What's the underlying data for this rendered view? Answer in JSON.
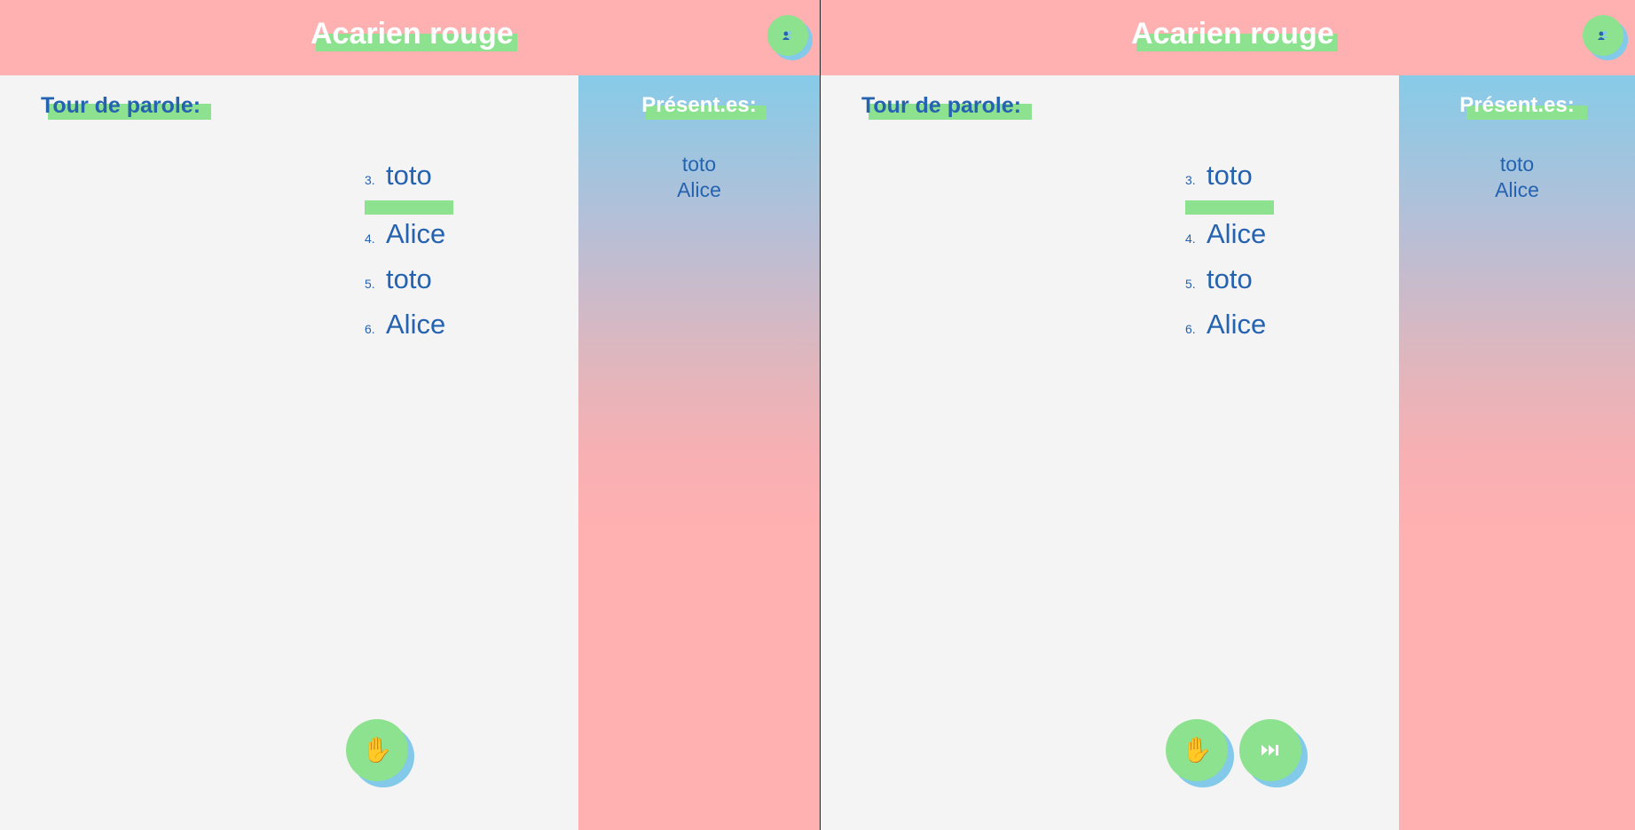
{
  "colors": {
    "header_bg": "#ffb0b1",
    "highlight": "#8de28f",
    "text_blue": "#2563b0",
    "sidebar_top": "#86cbe8",
    "sidebar_bottom": "#ffb0b1",
    "button_shadow": "#83c9ea"
  },
  "left": {
    "header": {
      "title": "Acarien rouge",
      "avatar_icon": "participants-icon"
    },
    "main": {
      "section_title": "Tour de parole:",
      "queue": [
        {
          "num": "3.",
          "name": "toto"
        },
        {
          "num": "4.",
          "name": "Alice"
        },
        {
          "num": "5.",
          "name": "toto"
        },
        {
          "num": "6.",
          "name": "Alice"
        }
      ],
      "raise_hand_icon": "✋"
    },
    "sidebar": {
      "title": "Présent.es:",
      "people": [
        "toto",
        "Alice"
      ]
    }
  },
  "right": {
    "header": {
      "title": "Acarien rouge",
      "avatar_icon": "participants-icon"
    },
    "main": {
      "section_title": "Tour de parole:",
      "queue": [
        {
          "num": "3.",
          "name": "toto"
        },
        {
          "num": "4.",
          "name": "Alice"
        },
        {
          "num": "5.",
          "name": "toto"
        },
        {
          "num": "6.",
          "name": "Alice"
        }
      ],
      "raise_hand_icon": "✋",
      "next_icon": "⏭"
    },
    "sidebar": {
      "title": "Présent.es:",
      "people": [
        "toto",
        "Alice"
      ]
    }
  }
}
